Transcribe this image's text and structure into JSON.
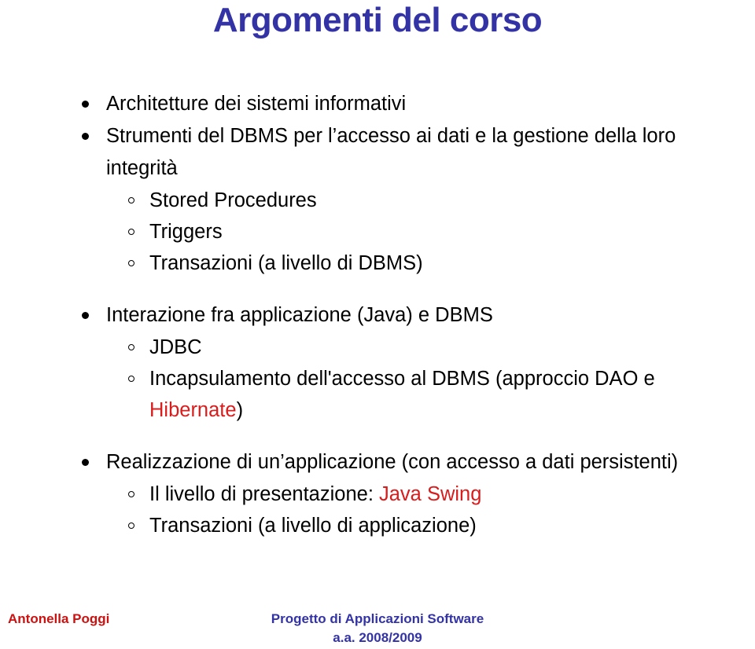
{
  "slide": {
    "title": "Argomenti del corso",
    "title_color": "#3333A6",
    "accent_red": "#D91C1C",
    "background": "#ffffff"
  },
  "content": {
    "groups": [
      {
        "items": [
          {
            "level": 1,
            "text": "Architetture dei sistemi informativi"
          },
          {
            "level": 1,
            "text": "Strumenti del DBMS per l’accesso ai dati e la gestione della loro integrità"
          },
          {
            "level": 2,
            "text": "Stored Procedures"
          },
          {
            "level": 2,
            "text": "Triggers"
          },
          {
            "level": 2,
            "text": "Transazioni (a livello di DBMS)"
          }
        ]
      },
      {
        "items": [
          {
            "level": 1,
            "text": "Interazione fra applicazione (Java) e DBMS"
          },
          {
            "level": 2,
            "text": "JDBC"
          },
          {
            "level": 2,
            "prefix": "Incapsulamento dell'accesso al DBMS (approccio DAO e ",
            "highlight": "Hibernate",
            "suffix": ")"
          }
        ]
      },
      {
        "items": [
          {
            "level": 1,
            "text": "Realizzazione di un’applicazione (con accesso a dati persistenti)"
          },
          {
            "level": 2,
            "prefix": "Il livello di presentazione: ",
            "highlight": "Java Swing",
            "suffix": ""
          },
          {
            "level": 2,
            "text": "Transazioni (a livello di applicazione)"
          }
        ]
      }
    ]
  },
  "footer": {
    "author": "Antonella Poggi",
    "course": "Progetto di Applicazioni Software",
    "academic_year": "a.a. 2008/2009",
    "author_color": "#CC1111",
    "course_color": "#3333A6"
  }
}
